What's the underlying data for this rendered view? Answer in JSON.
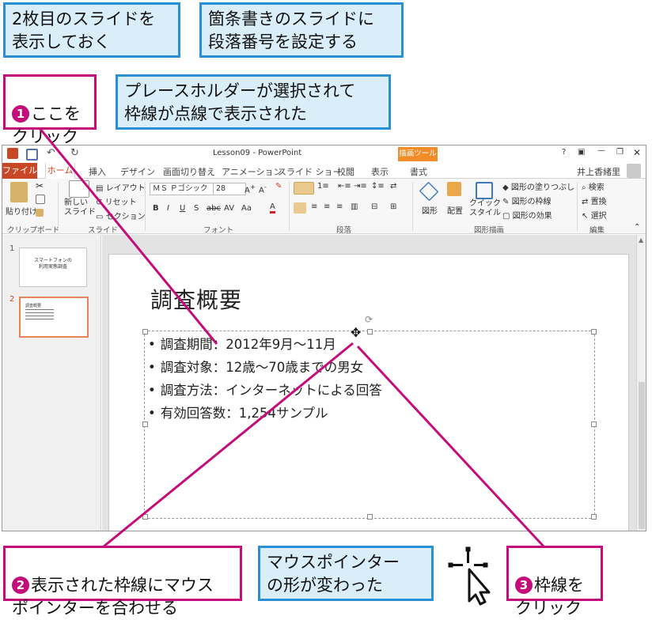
{
  "callouts": {
    "step0": "2枚目のスライドを\n表示しておく",
    "goal": "箇条書きのスライドに\n段落番号を設定する",
    "step1_num": "1",
    "step1": "ここを\nクリック",
    "note1": "プレースホルダーが選択されて\n枠線が点線で表示された",
    "step2_num": "2",
    "step2": "表示された枠線にマウス\nポインターを合わせる",
    "note2": "マウスポインター\nの形が変わった",
    "step3_num": "3",
    "step3": "枠線を\nクリック"
  },
  "app": {
    "window_title": "Lesson09 - PowerPoint",
    "context_tab": "描画ツール",
    "help": "?",
    "user": "井上香緒里",
    "tabs": [
      "ファイル",
      "ホーム",
      "挿入",
      "デザイン",
      "画面切り替え",
      "アニメーション",
      "スライド ショー",
      "校閲",
      "表示",
      "書式"
    ],
    "ribbon": {
      "paste": "貼り付け",
      "new_slide": "新しい\nスライド",
      "layout": "レイアウト",
      "reset": "リセット",
      "section": "セクション",
      "font_name": "ＭＳ Ｐゴシック",
      "font_size": "28",
      "font_btns": [
        "B",
        "I",
        "U",
        "S",
        "abc",
        "AV",
        "Aa"
      ],
      "shape": "図形",
      "arrange": "配置",
      "quick_style": "クイック\nスタイル",
      "shape_fill": "図形の塗りつぶし",
      "shape_outline": "図形の枠線",
      "shape_effect": "図形の効果",
      "find": "検索",
      "replace": "置換",
      "select": "選択",
      "groups": [
        "クリップボード",
        "スライド",
        "フォント",
        "段落",
        "図形描画",
        "編集"
      ]
    },
    "thumbnails": [
      {
        "num": "1",
        "line1": "スマートフォンの",
        "line2": "利用実態調査"
      },
      {
        "num": "2",
        "line1": "調査概要"
      }
    ],
    "slide": {
      "title": "調査概要",
      "bullets": [
        "調査期間：2012年9月～11月",
        "調査対象：12歳～70歳までの男女",
        "調査方法：インターネットによる回答",
        "有効回答数：1,254サンプル"
      ]
    }
  },
  "colors": {
    "accent_blue": "#2a8fd4",
    "accent_magenta": "#c40d7a",
    "ppt_orange": "#c84826"
  }
}
